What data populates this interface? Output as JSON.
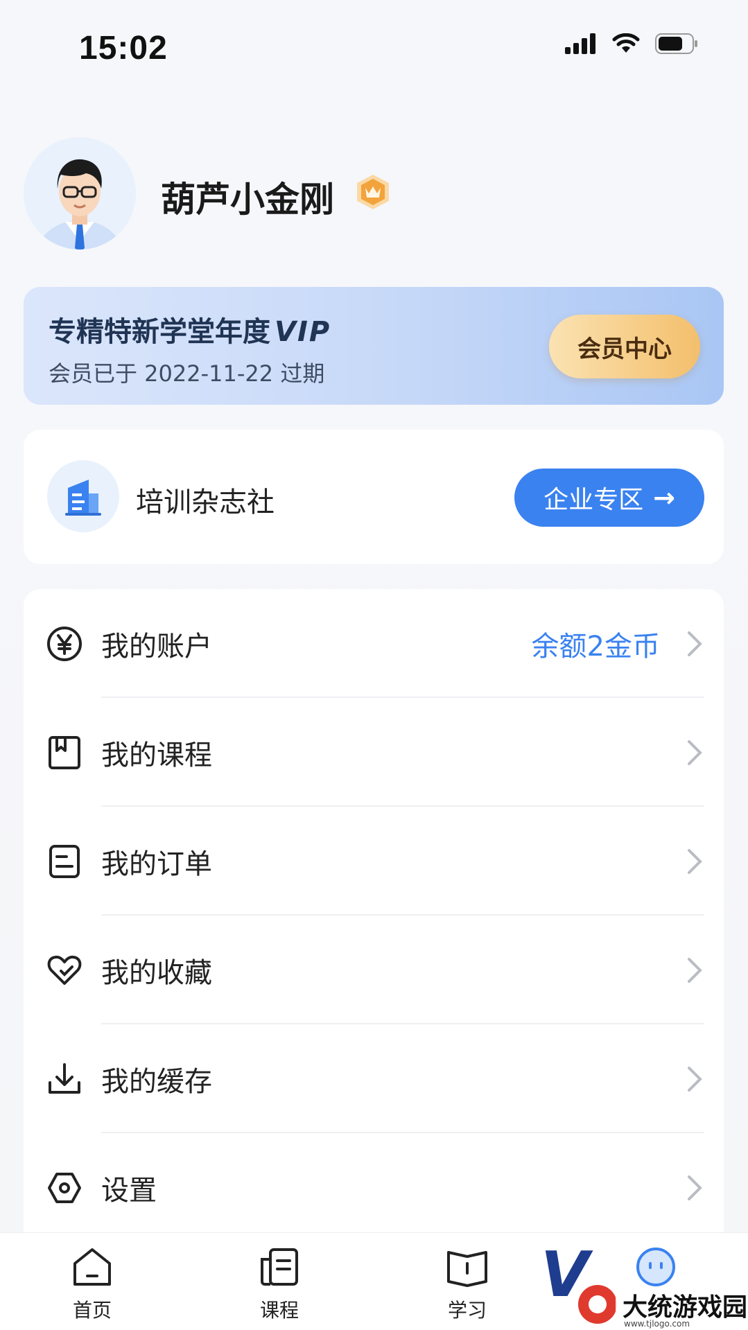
{
  "status_bar": {
    "time": "15:02"
  },
  "profile": {
    "username": "葫芦小金刚"
  },
  "vip": {
    "title": "专精特新学堂年度",
    "title_badge": "VIP",
    "subtitle": "会员已于 2022-11-22 过期",
    "button_label": "会员中心"
  },
  "org": {
    "name": "培训杂志社",
    "button_label": "企业专区",
    "button_arrow": "→"
  },
  "menu": {
    "items": [
      {
        "label": "我的账户",
        "value": "余额2金币",
        "icon": "yen-icon"
      },
      {
        "label": "我的课程",
        "value": "",
        "icon": "course-bookmark-icon"
      },
      {
        "label": "我的订单",
        "value": "",
        "icon": "order-document-icon"
      },
      {
        "label": "我的收藏",
        "value": "",
        "icon": "heart-icon"
      },
      {
        "label": "我的缓存",
        "value": "",
        "icon": "download-icon"
      },
      {
        "label": "设置",
        "value": "",
        "icon": "settings-hexagon-icon"
      }
    ]
  },
  "tabbar": {
    "tabs": [
      {
        "label": "首页",
        "icon": "home-icon"
      },
      {
        "label": "课程",
        "icon": "course-icon"
      },
      {
        "label": "学习",
        "icon": "book-icon"
      },
      {
        "label": "",
        "icon": "profile-face-icon"
      }
    ]
  },
  "watermark": {
    "text": "大统游戏园",
    "url_text": "www.tjlogo.com"
  },
  "colors": {
    "accent": "#3a82f0",
    "vip_gold": "#f3bf6c",
    "background": "#f5f6f8"
  }
}
